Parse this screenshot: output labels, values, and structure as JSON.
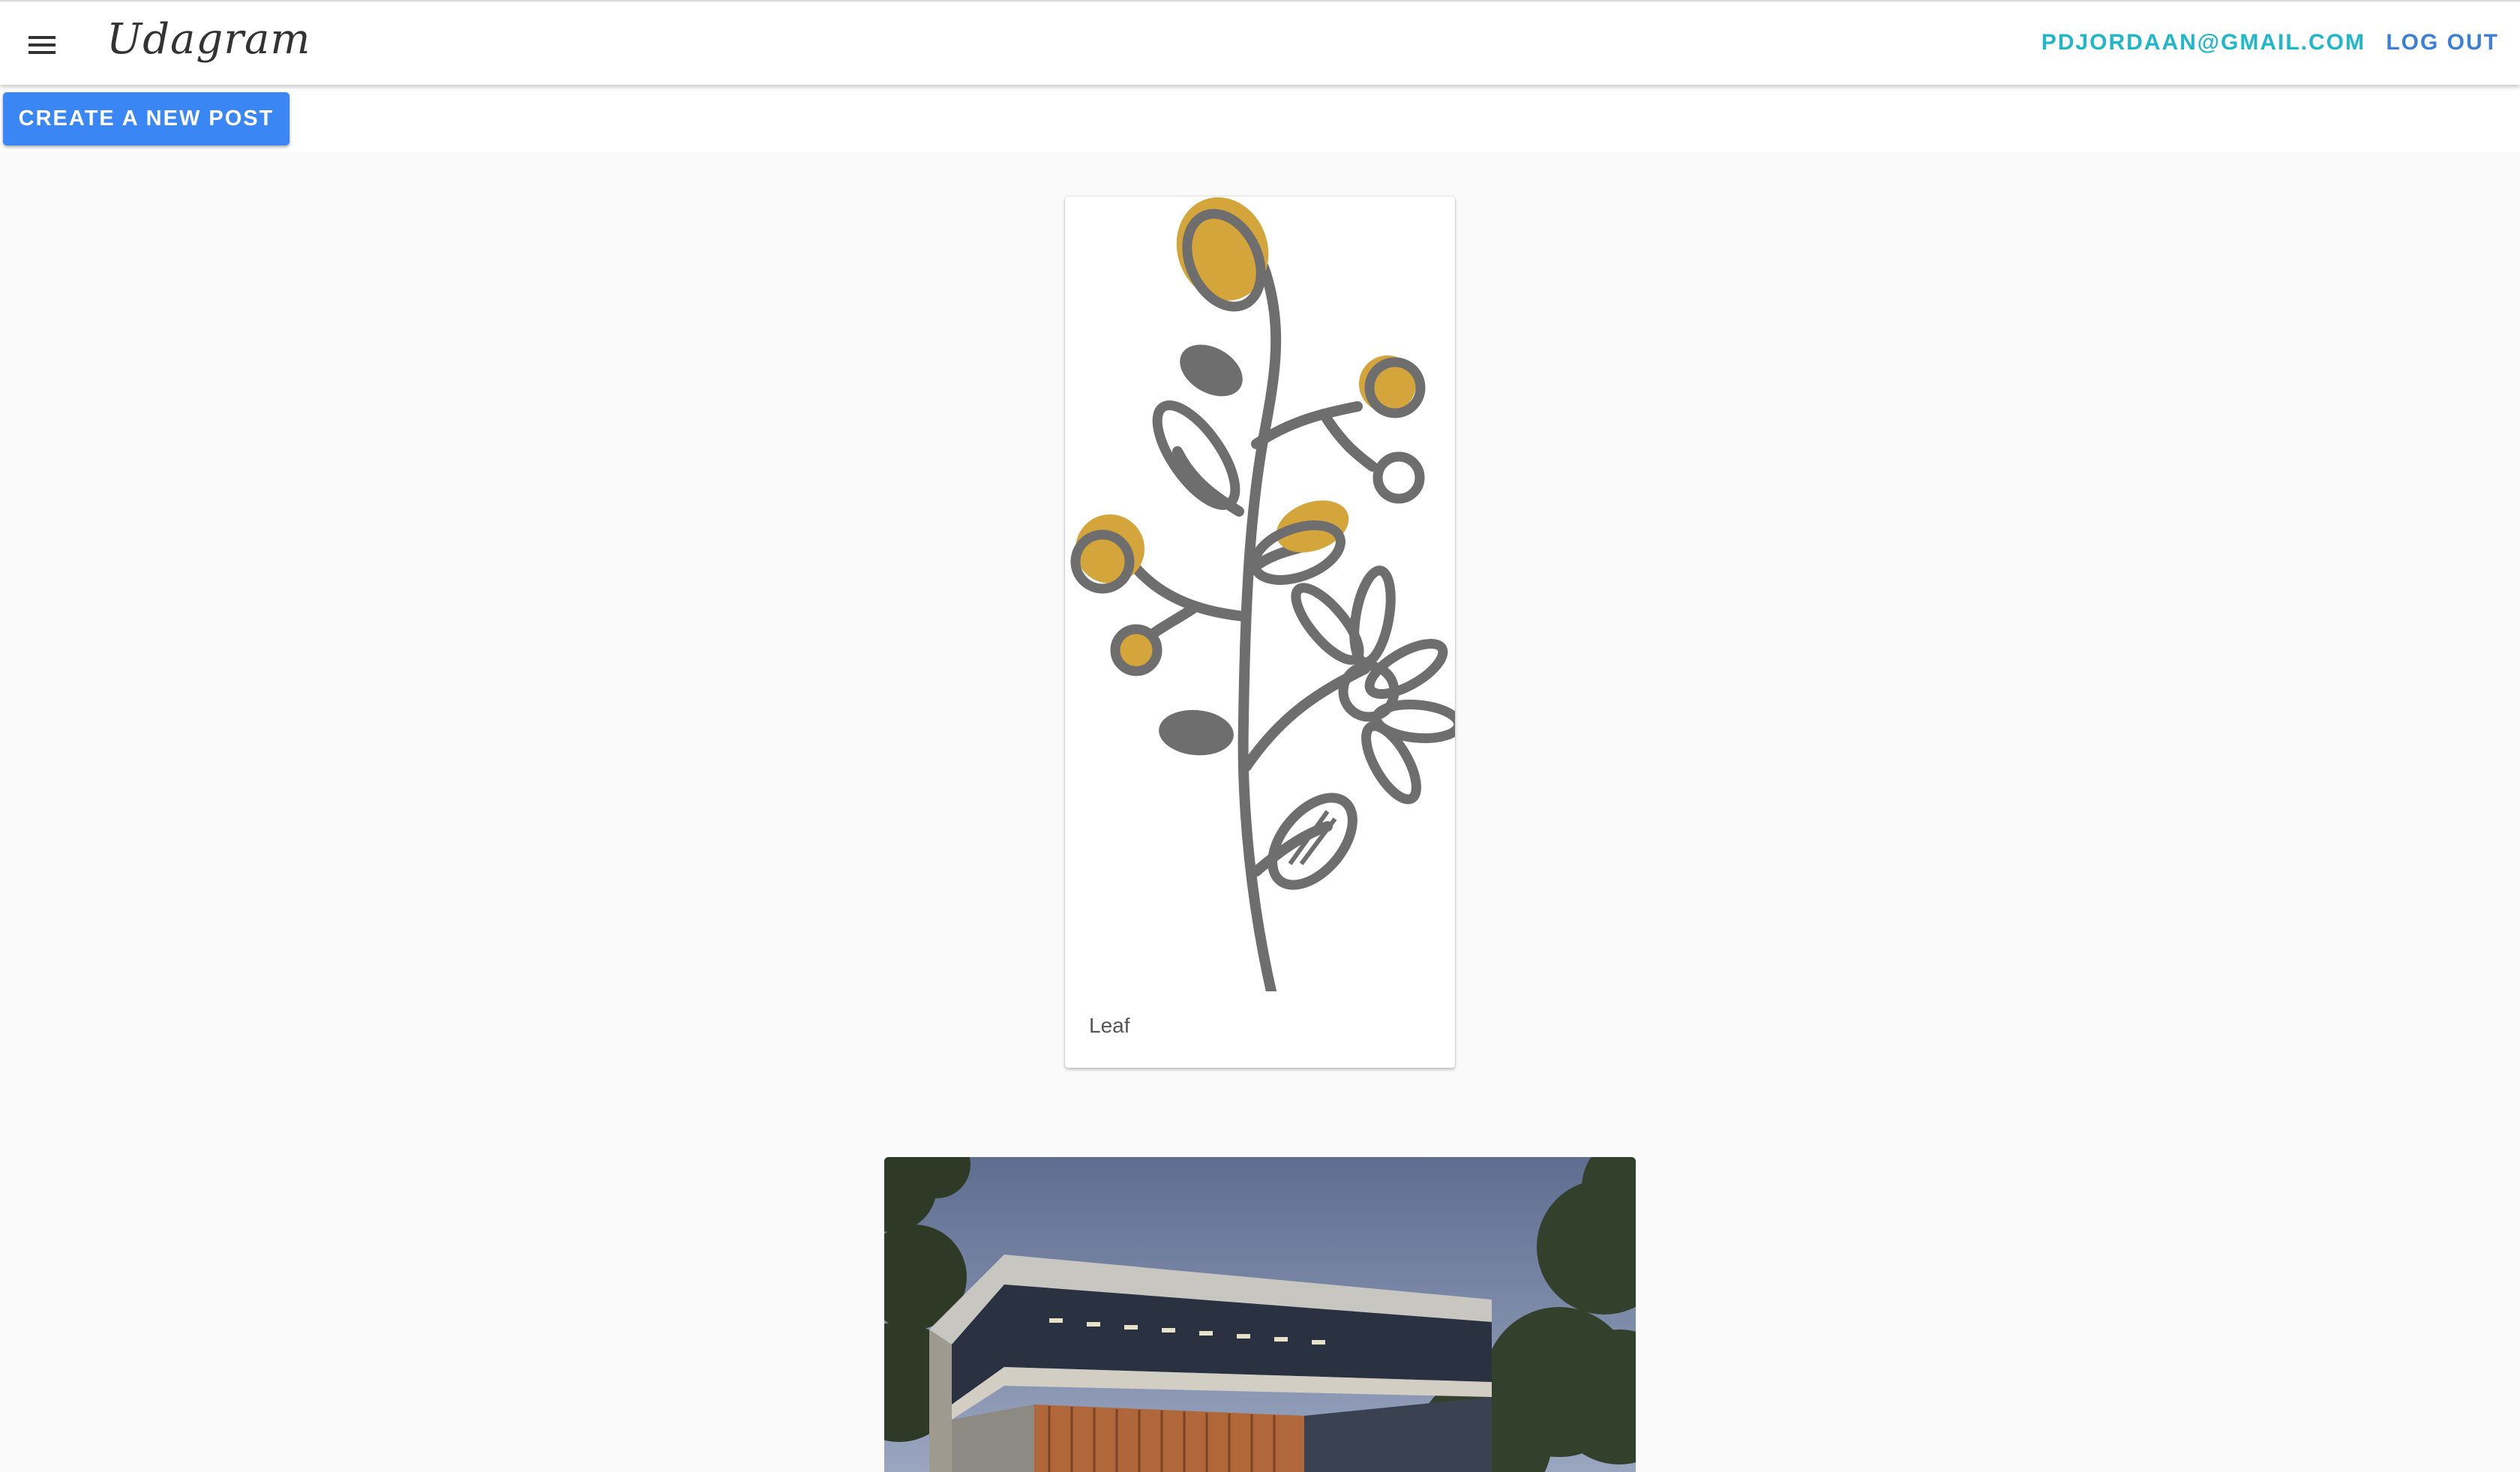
{
  "header": {
    "brand": "Udagram",
    "user_email": "PDJORDAAN@GMAIL.COM",
    "logout_label": "LOG OUT",
    "menu_icon": "hamburger-menu-icon"
  },
  "actions": {
    "create_label": "CREATE A NEW POST"
  },
  "colors": {
    "primary_button": "#3a86f5",
    "user_link": "#1fb7c9",
    "logout_link": "#3b7fd8",
    "background": "#fafafa",
    "leaf_stroke": "#6e6e6e",
    "leaf_accent": "#d4a53a"
  },
  "feed": {
    "posts": [
      {
        "caption": "Leaf",
        "image": "leaf-illustration"
      },
      {
        "caption": "",
        "image": "modern-building-photo"
      }
    ]
  }
}
